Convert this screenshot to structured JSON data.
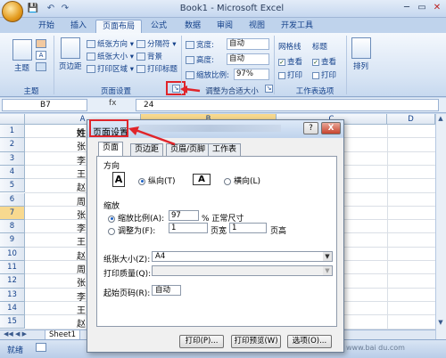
{
  "window": {
    "title": "Book1 - Microsoft Excel"
  },
  "qat": {
    "save": "💾",
    "undo": "↶",
    "redo": "↷"
  },
  "ribbon_tabs": [
    "开始",
    "插入",
    "页面布局",
    "公式",
    "数据",
    "审阅",
    "视图",
    "开发工具"
  ],
  "ribbon": {
    "theme": {
      "btn": "主题",
      "label": "主题"
    },
    "page_setup": {
      "margins": "页边距",
      "orientation": "纸张方向",
      "size": "纸张大小",
      "print_area": "打印区域",
      "breaks": "分隔符",
      "background": "背景",
      "print_titles": "打印标题",
      "label": "页面设置"
    },
    "scale": {
      "width_label": "宽度:",
      "width_value": "自动",
      "height_label": "高度:",
      "height_value": "自动",
      "scale_label": "缩放比例:",
      "scale_value": "97%",
      "label": "调整为合适大小"
    },
    "sheet_options": {
      "gridlines": "网格线",
      "headings": "标题",
      "view": "查看",
      "print": "打印",
      "label": "工作表选项"
    },
    "arrange": {
      "btn": "排列"
    }
  },
  "formula_bar": {
    "name_box": "B7",
    "fx": "fx",
    "content": "24"
  },
  "columns": [
    "A",
    "B",
    "C",
    "D"
  ],
  "rows": [
    "1",
    "2",
    "3",
    "4",
    "5",
    "6",
    "7",
    "8",
    "9",
    "10",
    "11",
    "12",
    "13",
    "14",
    "15",
    "16"
  ],
  "col_a_values": [
    "姓",
    "张",
    "李",
    "王",
    "赵",
    "周",
    "张",
    "李",
    "王",
    "赵",
    "周",
    "张",
    "李",
    "王",
    "赵"
  ],
  "sheet_tab": "Sheet1",
  "status": {
    "ready": "就绪"
  },
  "dialog": {
    "title": "页面设置",
    "tabs": [
      "页面",
      "页边距",
      "页眉/页脚",
      "工作表"
    ],
    "orientation_section": "方向",
    "portrait": "纵向(T)",
    "landscape": "横向(L)",
    "scaling_section": "缩放",
    "adjust_to": "缩放比例(A):",
    "adjust_value": "97",
    "adjust_suffix": "% 正常尺寸",
    "fit_to": "调整为(F):",
    "fit_wide": "1",
    "fit_wide_label": "页宽",
    "fit_tall": "1",
    "fit_tall_label": "页高",
    "paper_size_label": "纸张大小(Z):",
    "paper_size_value": "A4",
    "print_quality_label": "打印质量(Q):",
    "print_quality_value": "",
    "first_page_label": "起始页码(R):",
    "first_page_value": "自动",
    "print_btn": "打印(P)...",
    "preview_btn": "打印预览(W)",
    "options_btn": "选项(O)...",
    "help": "?",
    "close": "X"
  },
  "watermark": "www.bai du.com"
}
